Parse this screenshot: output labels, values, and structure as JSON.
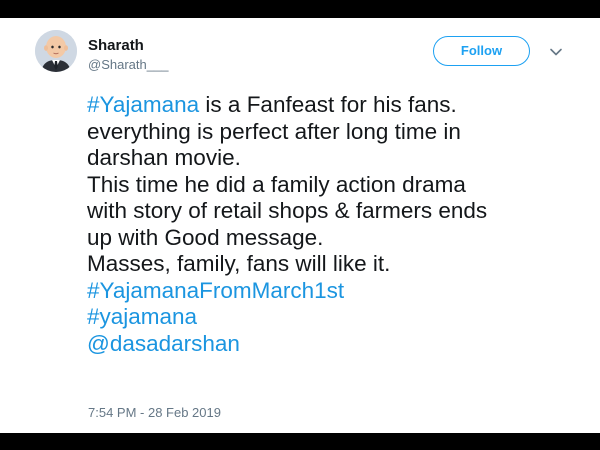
{
  "tweet": {
    "author": {
      "name": "Sharath",
      "handle": "@Sharath___",
      "avatar": "boss-baby-avatar"
    },
    "follow_label": "Follow",
    "more_icon": "chevron-down-icon",
    "lines": [
      {
        "hashtag": "#Yajamana",
        "text": " is a  Fanfeast for his fans."
      },
      {
        "text": "everything is perfect after long time in"
      },
      {
        "text": "darshan movie."
      },
      {
        "text": "This time he did a family action drama"
      },
      {
        "text": "with story of retail shops & farmers ends"
      },
      {
        "text": "up with Good message."
      },
      {
        "text": "Masses, family, fans will like it."
      },
      {
        "hashtag": "#YajamanaFromMarch1st"
      },
      {
        "hashtag": "#yajamana"
      },
      {
        "mention": "@dasadarshan"
      }
    ],
    "timestamp": "7:54 PM - 28 Feb 2019"
  },
  "colors": {
    "link": "#1b95e0",
    "follow": "#1da1f2",
    "text": "#14171a",
    "muted": "#657786",
    "frame": "#000000"
  }
}
